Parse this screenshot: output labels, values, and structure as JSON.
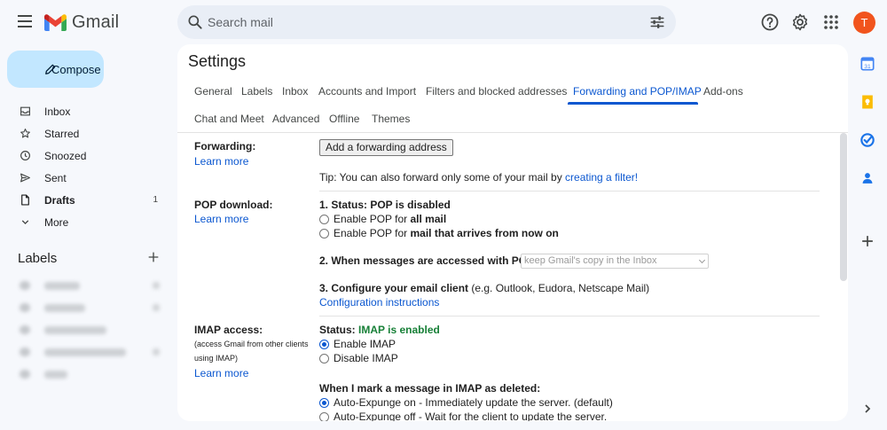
{
  "app": {
    "name": "Gmail"
  },
  "search": {
    "placeholder": "Search mail"
  },
  "account": {
    "initial": "T",
    "avatar_color": "#f1541d"
  },
  "compose": {
    "label": "Compose"
  },
  "nav": {
    "items": [
      {
        "label": "Inbox",
        "count": "",
        "bold": false,
        "icon": "inbox-icon"
      },
      {
        "label": "Starred",
        "count": "",
        "bold": false,
        "icon": "star-icon"
      },
      {
        "label": "Snoozed",
        "count": "",
        "bold": false,
        "icon": "clock-icon"
      },
      {
        "label": "Sent",
        "count": "",
        "bold": false,
        "icon": "send-icon"
      },
      {
        "label": "Drafts",
        "count": "1",
        "bold": true,
        "icon": "draft-icon"
      },
      {
        "label": "More",
        "count": "",
        "bold": false,
        "icon": "chevron-down-icon"
      }
    ]
  },
  "labels": {
    "heading": "Labels"
  },
  "settings": {
    "title": "Settings",
    "tabs_row1": [
      "General",
      "Labels",
      "Inbox",
      "Accounts and Import",
      "Filters and blocked addresses",
      "Forwarding and POP/IMAP",
      "Add-ons"
    ],
    "tabs_row2": [
      "Chat and Meet",
      "Advanced",
      "Offline",
      "Themes"
    ],
    "active_tab": "Forwarding and POP/IMAP",
    "forwarding": {
      "label": "Forwarding:",
      "learn_more": "Learn more",
      "button": "Add a forwarding address",
      "tip_prefix": "Tip: You can also forward only some of your mail by ",
      "tip_link": "creating a filter!"
    },
    "pop": {
      "label": "POP download:",
      "learn_more": "Learn more",
      "status": "1. Status: POP is disabled",
      "opt1_prefix": "Enable POP for ",
      "opt1_bold": "all mail",
      "opt2_prefix": "Enable POP for ",
      "opt2_bold": "mail that arrives from now on",
      "step2": "2. When messages are accessed with POP",
      "step2_select": "keep Gmail's copy in the Inbox",
      "step3_bold": "3. Configure your email client",
      "step3_rest": " (e.g. Outlook, Eudora, Netscape Mail)",
      "config_link": "Configuration instructions"
    },
    "imap": {
      "label": "IMAP access:",
      "note": "(access Gmail from other clients using IMAP)",
      "learn_more": "Learn more",
      "status_prefix": "Status: ",
      "status_value": "IMAP is enabled",
      "status_color": "#188038",
      "enable": "Enable IMAP",
      "disable": "Disable IMAP",
      "deleted_heading": "When I mark a message in IMAP as deleted:",
      "expunge_on": "Auto-Expunge on - Immediately update the server. (default)",
      "expunge_off": "Auto-Expunge off - Wait for the client to update the server."
    }
  },
  "colors": {
    "accent": "#0b57d0",
    "compose_bg": "#c2e7ff",
    "page_bg": "#f6f8fc"
  }
}
